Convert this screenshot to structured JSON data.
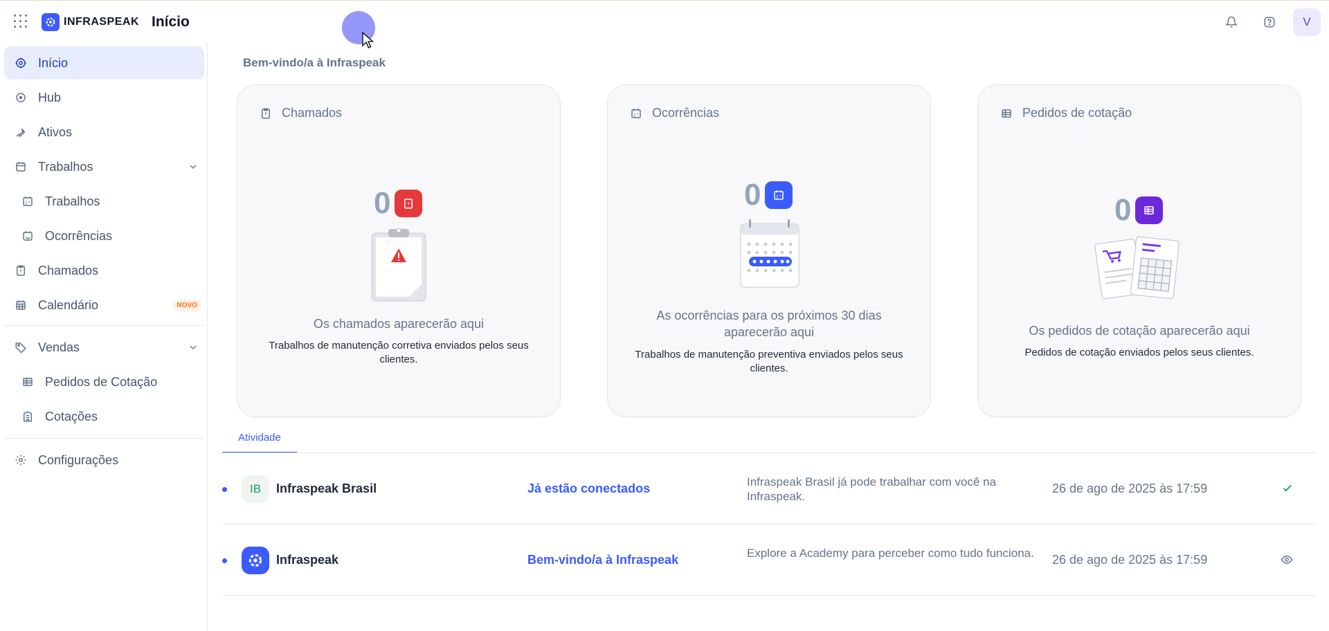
{
  "brand": {
    "name": "INFRASPEAK"
  },
  "header": {
    "page_title": "Início",
    "avatar_initial": "V"
  },
  "sidebar": {
    "items": [
      {
        "label": "Início",
        "icon": "target-icon"
      },
      {
        "label": "Hub",
        "icon": "hub-icon"
      },
      {
        "label": "Ativos",
        "icon": "wrench-icon"
      },
      {
        "label": "Trabalhos",
        "icon": "calendar-icon"
      },
      {
        "label": "Trabalhos",
        "icon": "calendar-icon"
      },
      {
        "label": "Ocorrências",
        "icon": "recurring-icon"
      },
      {
        "label": "Chamados",
        "icon": "clipboard-icon"
      },
      {
        "label": "Calendário",
        "icon": "calendar-grid-icon",
        "badge": "NOVO"
      },
      {
        "label": "Vendas",
        "icon": "tag-icon"
      },
      {
        "label": "Pedidos de Cotação",
        "icon": "table-icon"
      },
      {
        "label": "Cotações",
        "icon": "building-icon"
      },
      {
        "label": "Configurações",
        "icon": "gear-icon"
      }
    ]
  },
  "main": {
    "welcome": "Bem-vindo/a à Infraspeak",
    "cards": [
      {
        "title": "Chamados",
        "count": "0",
        "empty_title": "Os chamados aparecerão aqui",
        "empty_desc": "Trabalhos de manutenção corretiva enviados pelos seus clientes.",
        "accent": "#e5393b"
      },
      {
        "title": "Ocorrências",
        "count": "0",
        "empty_title": "As ocorrências para os próximos 30 dias aparecerão aqui",
        "empty_desc": "Trabalhos de manutenção preventiva enviados pelos seus clientes.",
        "accent": "#3b5bfd"
      },
      {
        "title": "Pedidos de cotação",
        "count": "0",
        "empty_title": "Os pedidos de cotação aparecerão aqui",
        "empty_desc": "Pedidos de cotação enviados pelos seus clientes.",
        "accent": "#6d28d9"
      }
    ],
    "tabs": [
      {
        "label": "Atividade"
      }
    ],
    "activity": [
      {
        "avatar": "IB",
        "name": "Infraspeak Brasil",
        "link": "Já estão conectados",
        "message": "Infraspeak Brasil já pode trabalhar com você na Infraspeak.",
        "date": "26 de ago de 2025 às 17:59",
        "status_icon": "check-icon"
      },
      {
        "avatar": "",
        "name": "Infraspeak",
        "link": "Bem-vindo/a à Infraspeak",
        "message": "Explore a Academy para perceber como tudo funciona.",
        "date": "26 de ago de 2025 às 17:59",
        "status_icon": "eye-icon"
      }
    ]
  },
  "colors": {
    "accent": "#3b5bfd",
    "active_nav_bg": "#e8edfd",
    "success": "#16a34a"
  }
}
